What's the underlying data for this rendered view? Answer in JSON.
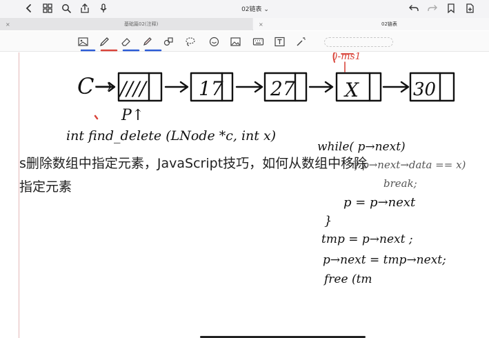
{
  "header": {
    "doc_title": "02链表 ⌄"
  },
  "tabs": [
    {
      "label": "基础篇02(注释)",
      "close": "×"
    },
    {
      "label": "02链表",
      "close": "×"
    }
  ],
  "overlay_text": {
    "line1": "s删除数组中指定元素，JavaScript技巧，如何从数组中移除",
    "line2": "指定元素"
  },
  "handwriting": {
    "ptr_label": "C→",
    "nodes": [
      "////",
      "17",
      "27",
      "X",
      "30"
    ],
    "annotation_top": ")-ms1",
    "p_label": "P↑",
    "signature": "int find_delete (LNode *c, int x)",
    "code": [
      "while( p→next)",
      "if p→next→data == x)",
      "break;",
      "p = p→next",
      "}",
      "tmp = p→next ;",
      "p→next = tmp→next;",
      "free (tm"
    ]
  },
  "colors": {
    "accent_red": "#d9453b",
    "ink": "#111111",
    "pen_blue": "#2c5cd6"
  }
}
